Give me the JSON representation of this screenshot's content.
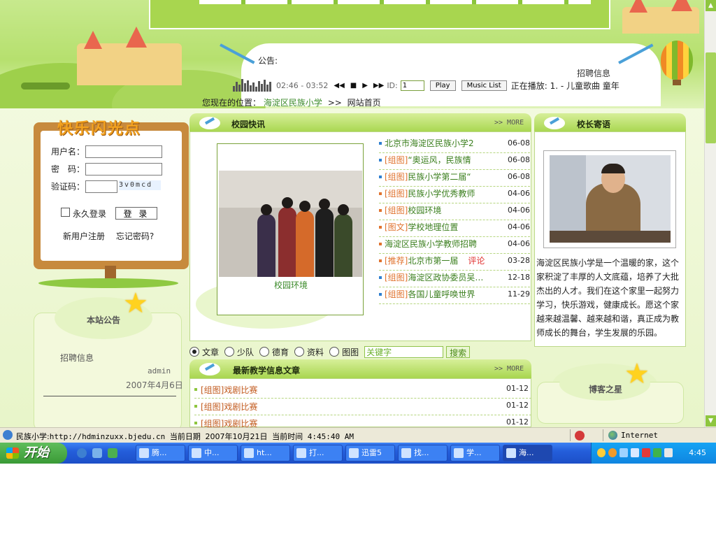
{
  "header": {
    "notice_label": "公告:",
    "recruit_link": "招聘信息",
    "player": {
      "time": "02:46 - 03:52",
      "id_label": "ID:",
      "id_value": "1",
      "play_label": "Play",
      "music_list_label": "Music List",
      "now_playing": "正在播放: 1. - 儿童歌曲  童年"
    },
    "breadcrumb": {
      "prefix": "您现在的位置：",
      "school": "海淀区民族小学",
      "sep": ">>",
      "current": "网站首页"
    }
  },
  "login": {
    "title": "快乐闪光点",
    "username_label": "用户名：",
    "password_label": "密　码：",
    "captcha_label": "验证码：",
    "captcha_value": "3v0mcd",
    "remember_label": "永久登录",
    "login_button": "登 录",
    "register_link": "新用户注册",
    "forgot_link": "忘记密码?"
  },
  "site_notice": {
    "title": "本站公告",
    "item": "招聘信息",
    "author": "admin",
    "date": "2007年4月6日"
  },
  "campus_news": {
    "title": "校园快讯",
    "more": ">> MORE",
    "photo_caption": "校园环境",
    "items": [
      {
        "tag": "",
        "text": "北京市海淀区民族小学2",
        "extra": "",
        "date": "06-08",
        "dot": "#2f7fd0"
      },
      {
        "tag": "[组图]",
        "text": "“奥运风，民族情",
        "extra": "",
        "date": "06-08",
        "dot": "#2f7fd0"
      },
      {
        "tag": "[组图]",
        "text": "民族小学第二届“",
        "extra": "",
        "date": "06-08",
        "dot": "#2f7fd0"
      },
      {
        "tag": "[组图]",
        "text": "民族小学优秀教师",
        "extra": "",
        "date": "04-06",
        "dot": "#e0732f"
      },
      {
        "tag": "[组图]",
        "text": "校园环境",
        "extra": "",
        "date": "04-06",
        "dot": "#e0732f"
      },
      {
        "tag": "[图文]",
        "text": "学校地理位置",
        "extra": "",
        "date": "04-06",
        "dot": "#e0732f"
      },
      {
        "tag": "",
        "text": "海淀区民族小学教师招聘",
        "extra": "",
        "date": "04-06",
        "dot": "#e0732f"
      },
      {
        "tag": "[推荐]",
        "text": "北京市第一届",
        "extra": "评论",
        "date": "03-28",
        "dot": "#e0732f"
      },
      {
        "tag": "[组图]",
        "text": "海淀区政协委员吴…",
        "extra": "",
        "date": "12-18",
        "dot": "#2f7fd0"
      },
      {
        "tag": "[组图]",
        "text": "各国儿童呼唤世界",
        "extra": "",
        "date": "11-29",
        "dot": "#2f7fd0"
      }
    ]
  },
  "search": {
    "options": [
      "文章",
      "少队",
      "德育",
      "资料",
      "图图"
    ],
    "selected": 0,
    "placeholder": "关键字",
    "button": "搜索"
  },
  "latest_articles": {
    "title": "最新教学信息文章",
    "more": ">> MORE",
    "items": [
      {
        "text": "[组图]戏剧比赛",
        "date": "01-12"
      },
      {
        "text": "[组图]戏剧比赛",
        "date": "01-12"
      },
      {
        "text": "[组图]戏剧比赛",
        "date": "01-12"
      }
    ]
  },
  "principal": {
    "title": "校长寄语",
    "text": "海淀区民族小学是一个温暖的家，这个家积淀了丰厚的人文底蕴，培养了大批杰出的人才。我们在这个家里一起努力学习，快乐游戏，健康成长。愿这个家越来越温馨、越来越和谐，真正成为教师成长的舞台，学生发展的乐园。"
  },
  "blog_star": {
    "title": "博客之星"
  },
  "statusbar": {
    "text_prefix": "民族小学:",
    "url": "http://hdminzuxx.bjedu.cn",
    "date_label": "当前日期",
    "date_value": "2007年10月21日",
    "time_label": "当前时间",
    "time_value": "4:45:40 AM",
    "zone": "Internet"
  },
  "taskbar": {
    "start_label": "开始",
    "tasks": [
      "腾...",
      "中...",
      "ht...",
      "打...",
      "迅雷5",
      "找...",
      "学...",
      "海..."
    ],
    "active_index": 7,
    "clock": "4:45"
  },
  "colors": {
    "accent_green": "#a8d64f",
    "link_green": "#3b7f1e",
    "tag_orange": "#e0732f",
    "hot_red": "#e0302f",
    "taskbar_blue": "#245edb"
  }
}
